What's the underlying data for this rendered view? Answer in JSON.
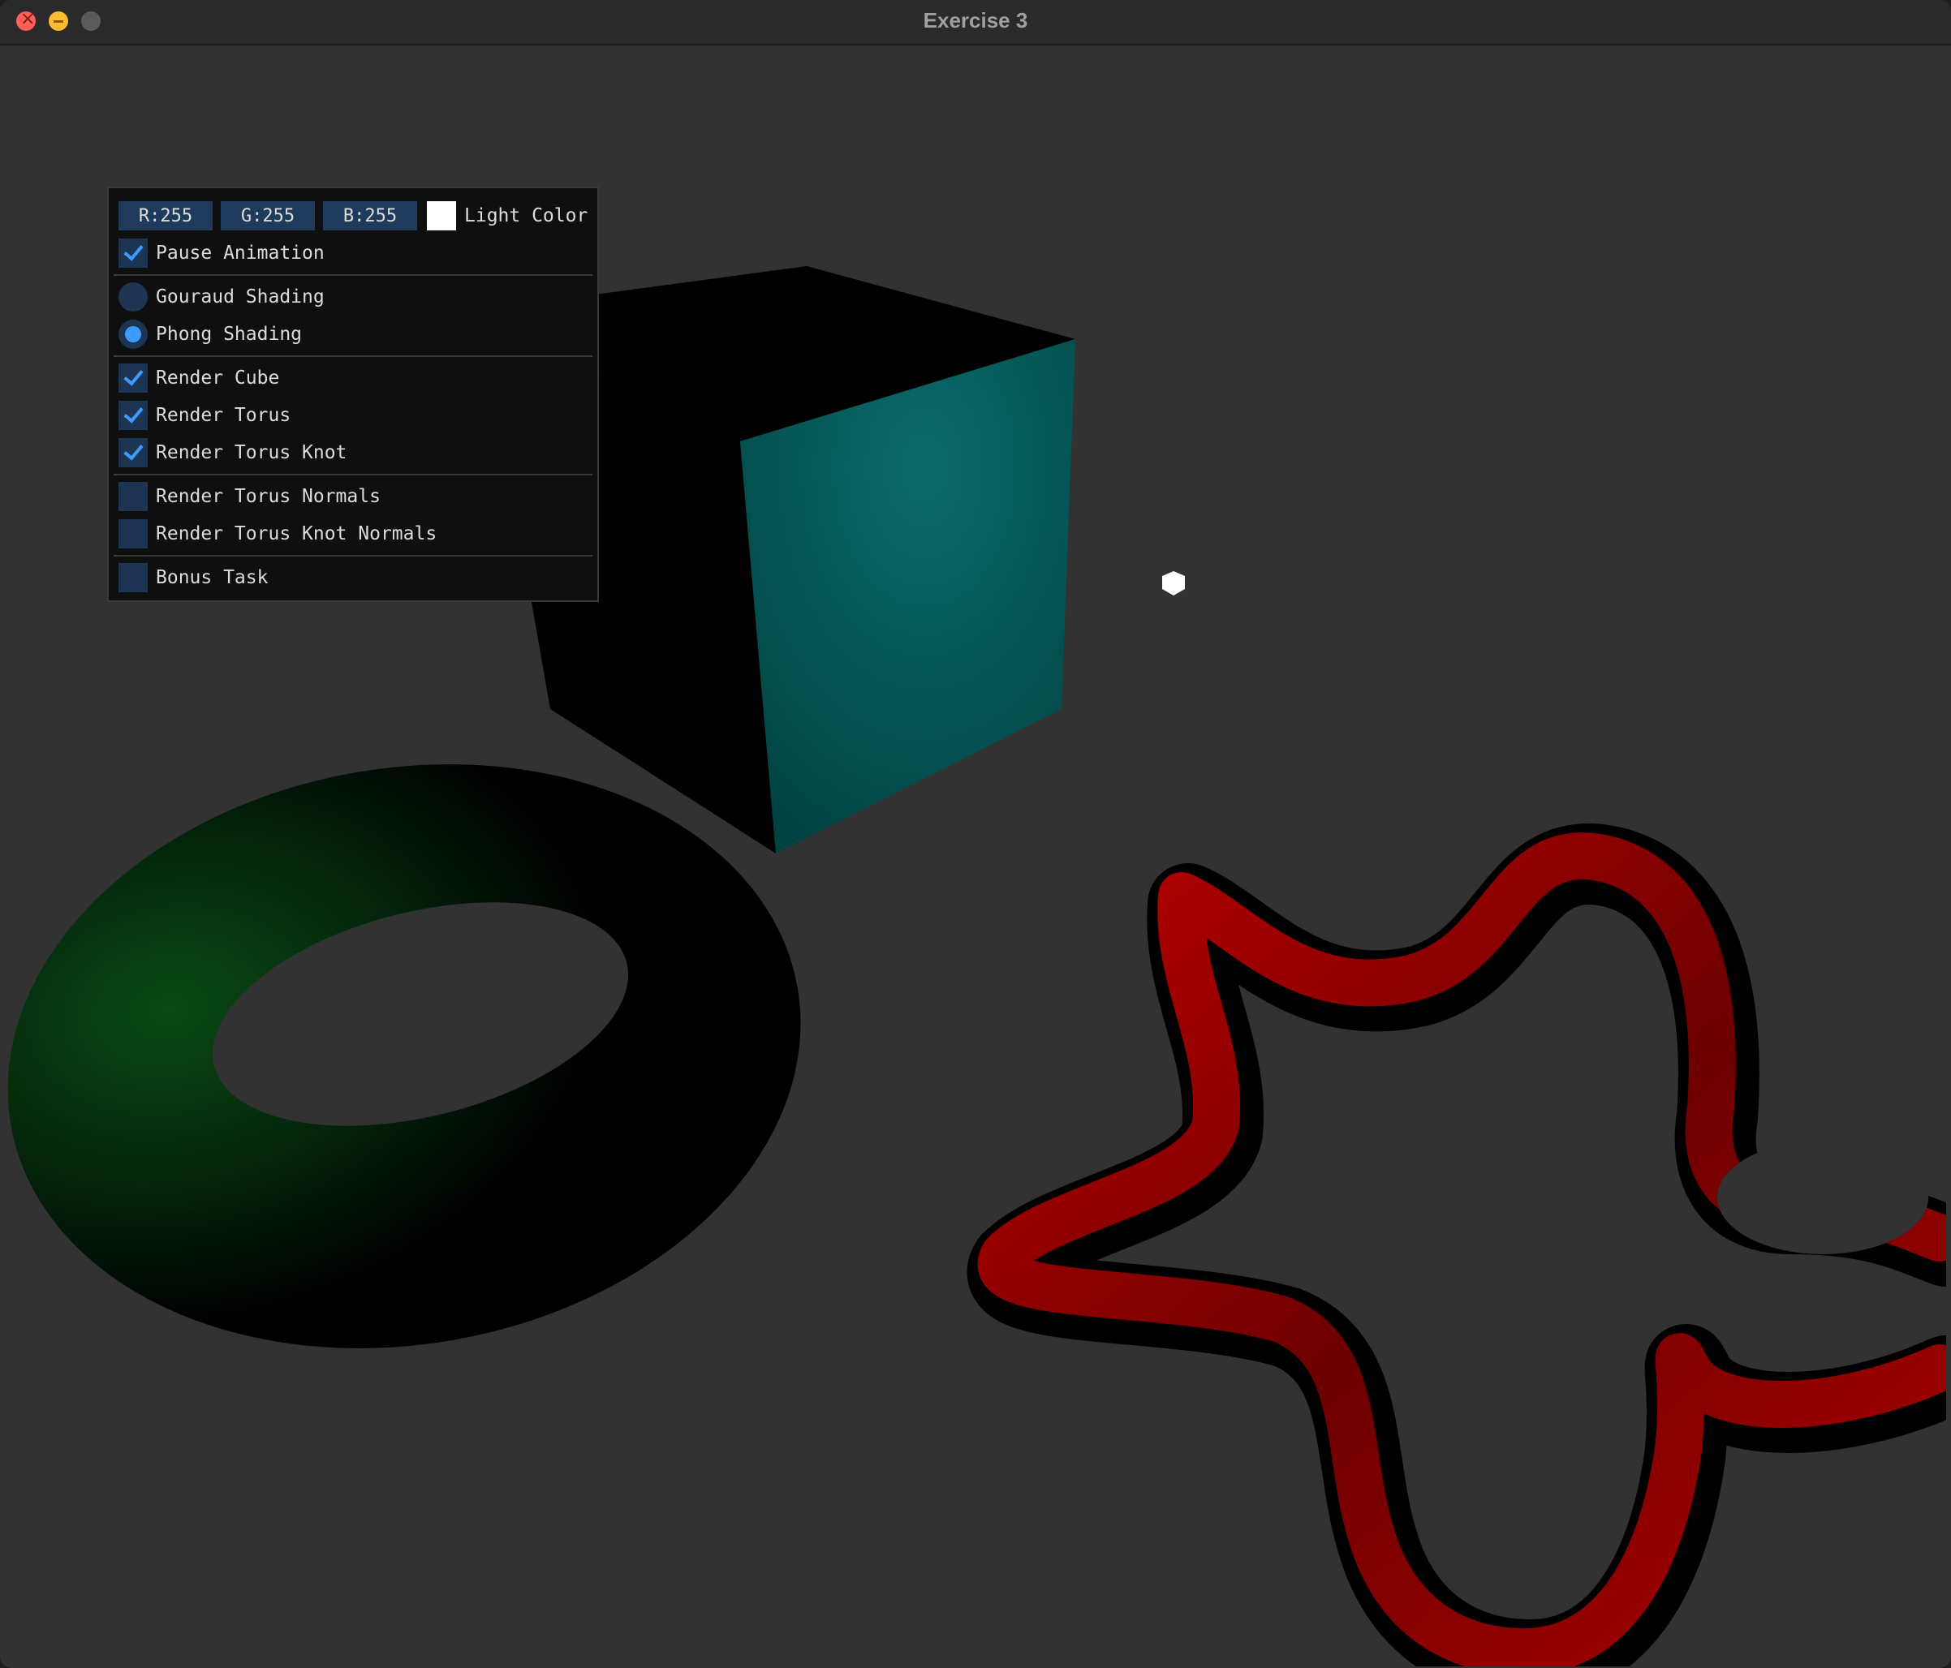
{
  "window": {
    "title": "Exercise 3"
  },
  "panel": {
    "light": {
      "r": "R:255",
      "g": "G:255",
      "b": "B:255",
      "label": "Light Color",
      "swatch_color": "#ffffff"
    },
    "pause_animation": {
      "label": "Pause Animation",
      "checked": true
    },
    "shading": [
      {
        "label": "Gouraud Shading",
        "selected": false
      },
      {
        "label": "Phong Shading",
        "selected": true
      }
    ],
    "render": [
      {
        "label": "Render Cube",
        "checked": true
      },
      {
        "label": "Render Torus",
        "checked": true
      },
      {
        "label": "Render Torus Knot",
        "checked": true
      }
    ],
    "normals": [
      {
        "label": "Render Torus Normals",
        "checked": false
      },
      {
        "label": "Render Torus Knot Normals",
        "checked": false
      }
    ],
    "bonus": {
      "label": "Bonus Task",
      "checked": false
    }
  },
  "scene": {
    "background_color": "#323232",
    "cube_color": "#006666",
    "torus_color": "#004d12",
    "torus_knot_color": "#cc0000",
    "light_color": "#ffffff"
  }
}
